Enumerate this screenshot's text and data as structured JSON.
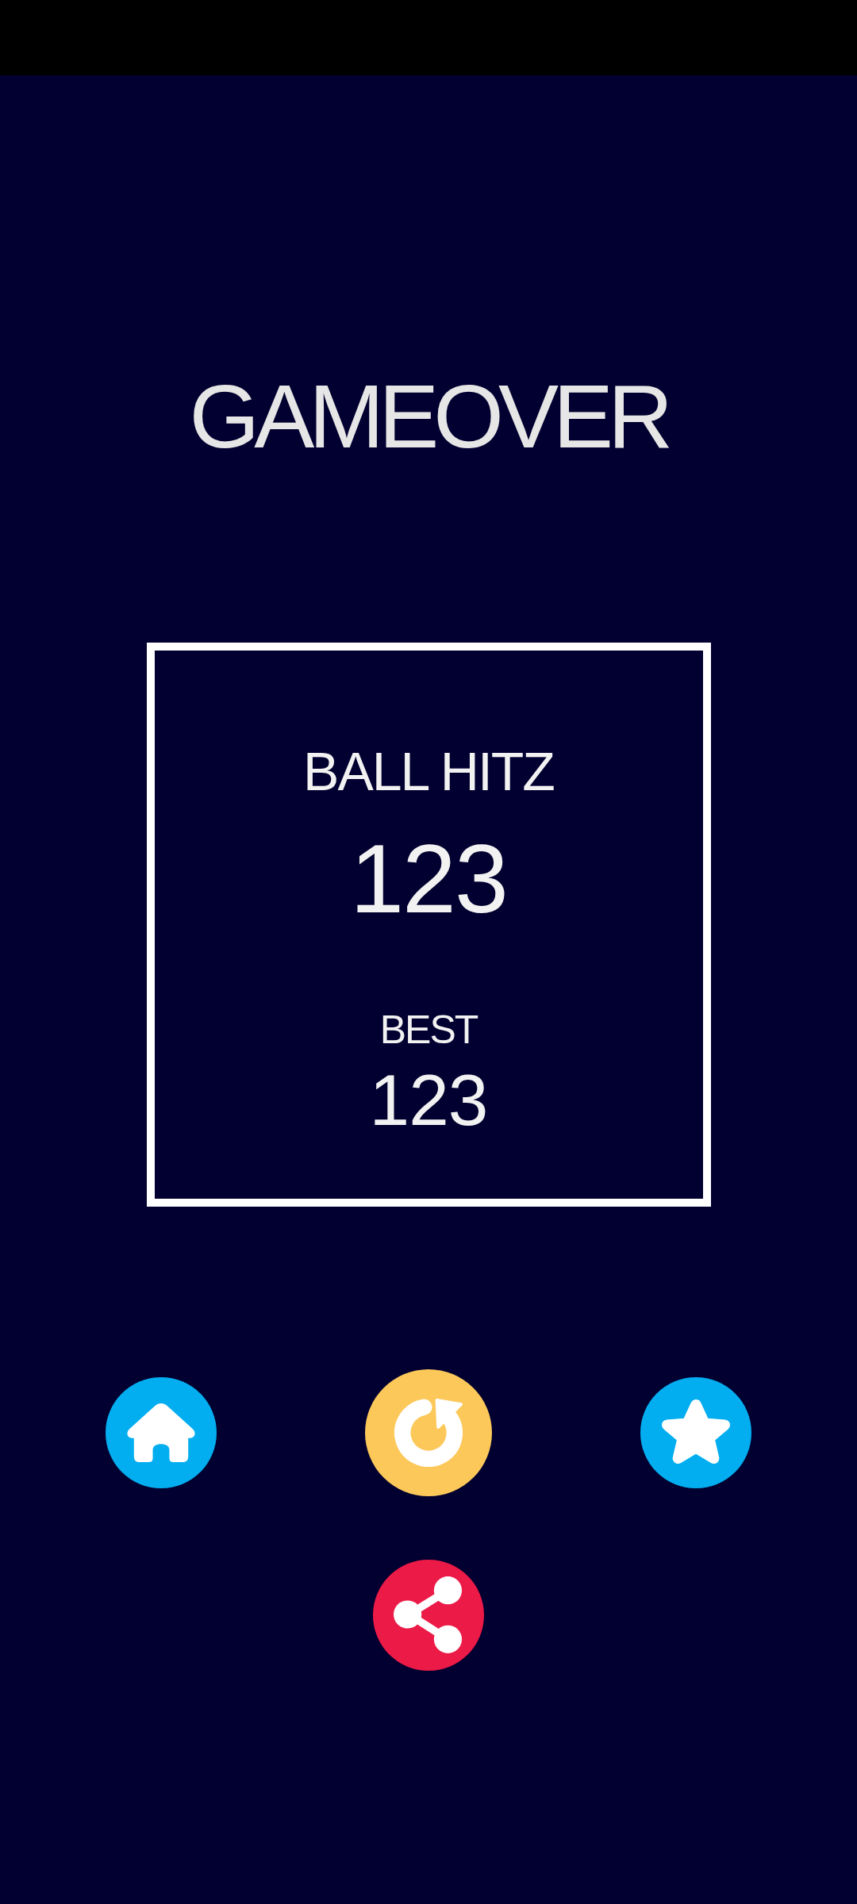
{
  "title": "GAMEOVER",
  "score_panel": {
    "game_name": "BALL HITZ",
    "score": "123",
    "best_label": "BEST",
    "best_score": "123"
  },
  "buttons": [
    {
      "kind": "home",
      "color": "#03aef0"
    },
    {
      "kind": "replay",
      "color": "#fcc85a"
    },
    {
      "kind": "star",
      "color": "#03aef0"
    },
    {
      "kind": "share",
      "color": "#eb1a47"
    }
  ]
}
